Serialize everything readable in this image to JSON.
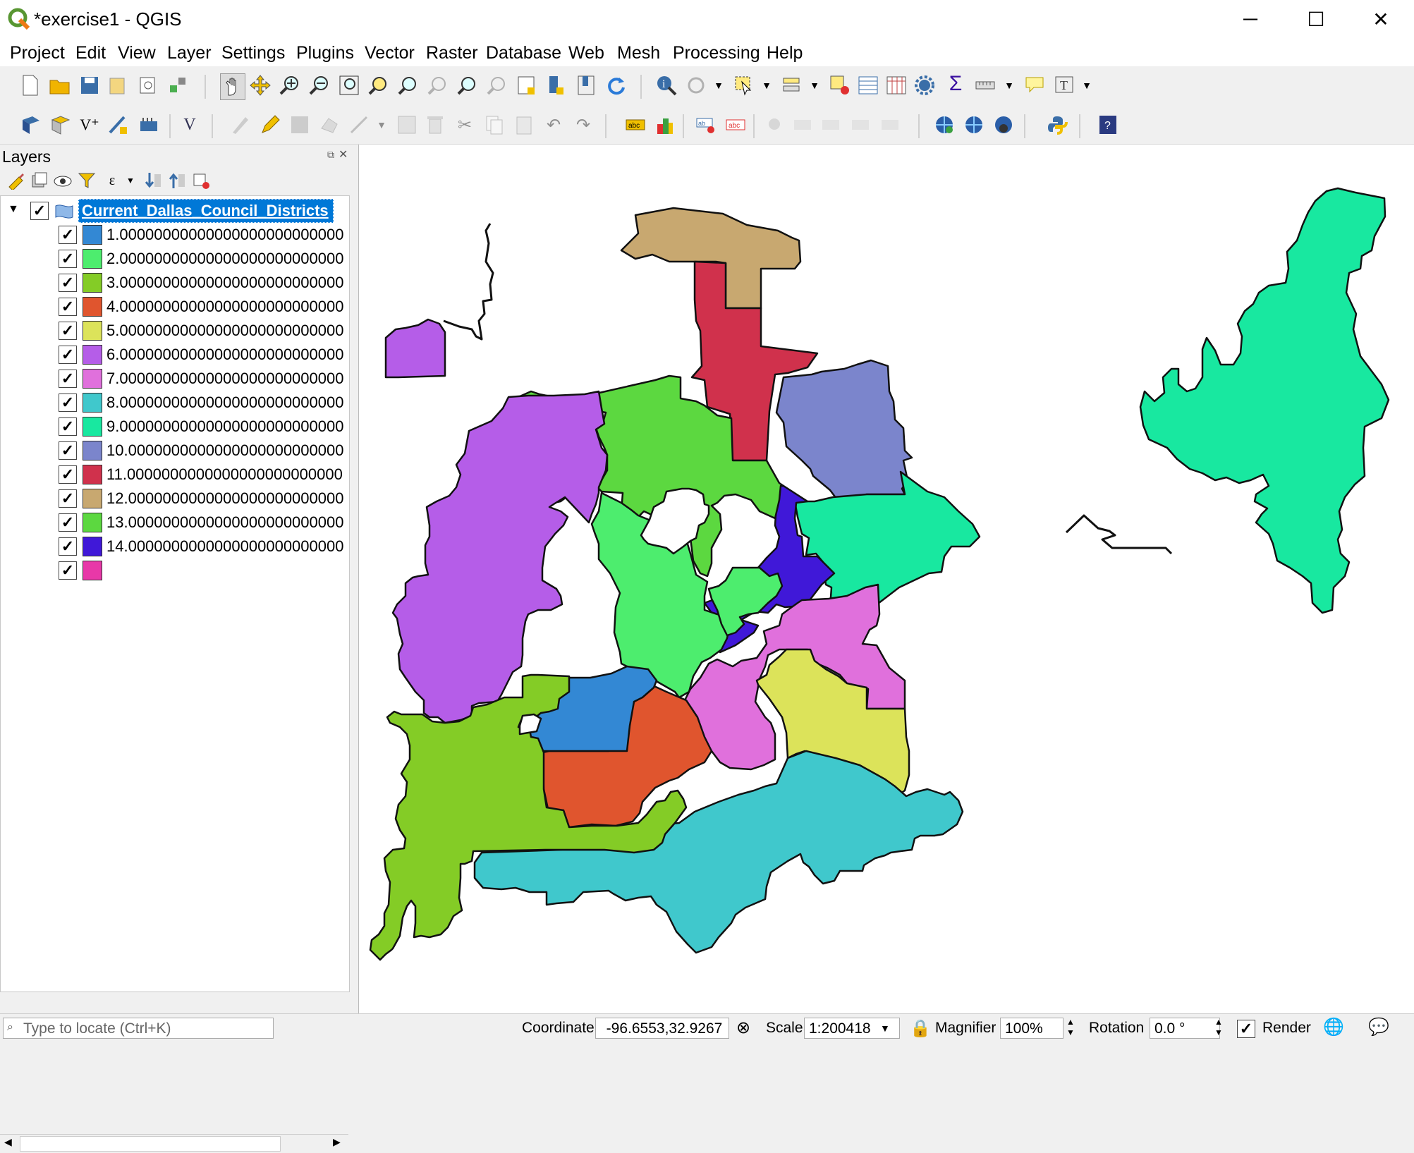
{
  "window": {
    "title": "*exercise1 - QGIS",
    "minimize": "─",
    "maximize": "☐",
    "close": "✕"
  },
  "menu": [
    "Project",
    "Edit",
    "View",
    "Layer",
    "Settings",
    "Plugins",
    "Vector",
    "Raster",
    "Database",
    "Web",
    "Mesh",
    "Processing",
    "Help"
  ],
  "layers": {
    "panel_title": "Layers",
    "layer_name": "Current_Dallas_Council_Districts",
    "classes": [
      {
        "label": "1.00000000000000000000000000",
        "color": "#3388d4"
      },
      {
        "label": "2.00000000000000000000000000",
        "color": "#4ded6e"
      },
      {
        "label": "3.00000000000000000000000000",
        "color": "#84cc26"
      },
      {
        "label": "4.00000000000000000000000000",
        "color": "#e0552e"
      },
      {
        "label": "5.00000000000000000000000000",
        "color": "#dce35a"
      },
      {
        "label": "6.00000000000000000000000000",
        "color": "#b55de8"
      },
      {
        "label": "7.00000000000000000000000000",
        "color": "#e070dc"
      },
      {
        "label": "8.00000000000000000000000000",
        "color": "#40c8cc"
      },
      {
        "label": "9.00000000000000000000000000",
        "color": "#18e8a0"
      },
      {
        "label": "10.0000000000000000000000000",
        "color": "#7b85cc"
      },
      {
        "label": "11.0000000000000000000000000",
        "color": "#d0314c"
      },
      {
        "label": "12.0000000000000000000000000",
        "color": "#c8a870"
      },
      {
        "label": "13.0000000000000000000000000",
        "color": "#5cd840"
      },
      {
        "label": "14.0000000000000000000000000",
        "color": "#4018d8"
      },
      {
        "label": "",
        "color": "#e838a8"
      }
    ]
  },
  "status": {
    "locate_placeholder": "Type to locate (Ctrl+K)",
    "coordinate_label": "Coordinate",
    "coordinate_value": "-96.6553,32.9267",
    "scale_label": "Scale",
    "scale_value": "1:200418",
    "magnifier_label": "Magnifier",
    "magnifier_value": "100%",
    "rotation_label": "Rotation",
    "rotation_value": "0.0 °",
    "render_label": "Render"
  }
}
